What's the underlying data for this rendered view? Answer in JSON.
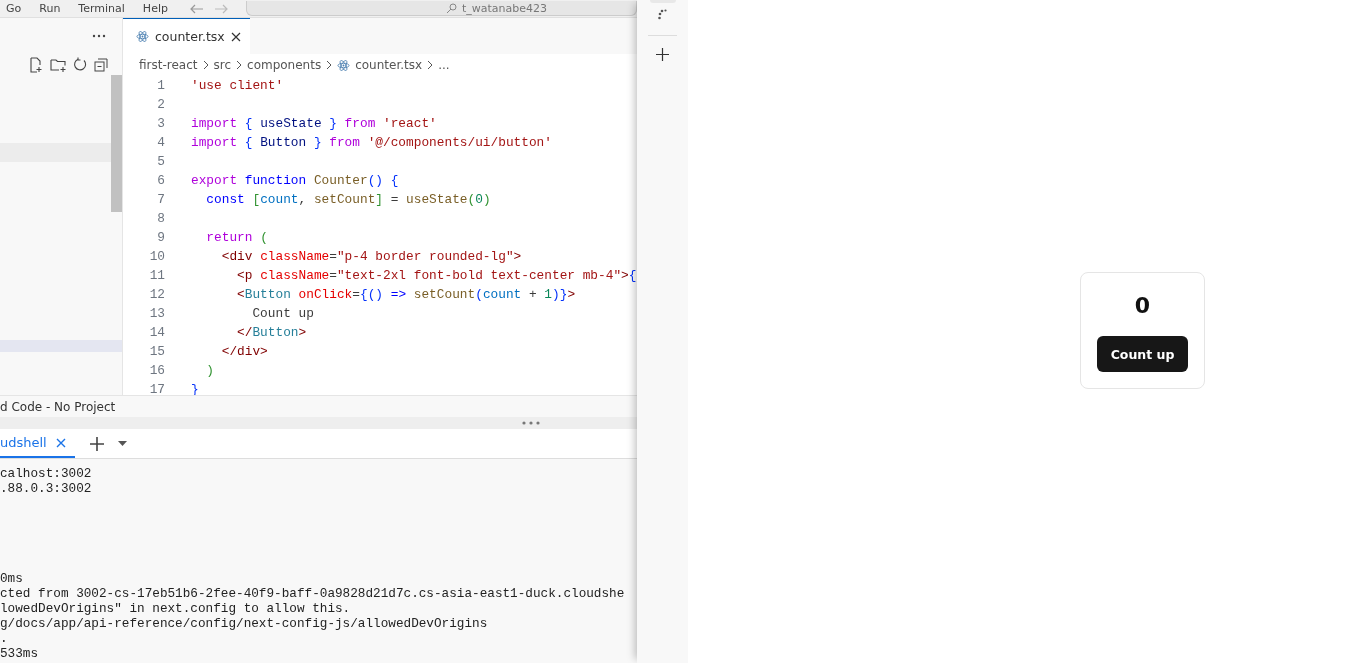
{
  "menu": [
    "Go",
    "Run",
    "Terminal",
    "Help"
  ],
  "command_center": {
    "text": "t_watanabe423"
  },
  "editor": {
    "tab": {
      "label": "counter.tsx",
      "selected": true
    },
    "breadcrumb": [
      "first-react",
      "src",
      "components",
      "counter.tsx",
      "..."
    ],
    "lines": [
      {
        "number": "1",
        "tokens": [
          {
            "text": "'use client'",
            "kind": "str"
          }
        ]
      },
      {
        "number": "2"
      },
      {
        "number": "3",
        "tokens": [
          {
            "text": "import ",
            "kind": "kw"
          },
          {
            "text": "{ ",
            "kind": "br1"
          },
          {
            "text": "useState ",
            "kind": "var"
          },
          {
            "text": "} ",
            "kind": "br1"
          },
          {
            "text": "from ",
            "kind": "kw"
          },
          {
            "text": "'react'",
            "kind": "str"
          }
        ]
      },
      {
        "number": "4",
        "tokens": [
          {
            "text": "import ",
            "kind": "kw"
          },
          {
            "text": "{ ",
            "kind": "br1"
          },
          {
            "text": "Button ",
            "kind": "var"
          },
          {
            "text": "} ",
            "kind": "br1"
          },
          {
            "text": "from ",
            "kind": "kw"
          },
          {
            "text": "'@/components/ui/button'",
            "kind": "str"
          }
        ]
      },
      {
        "number": "5"
      },
      {
        "number": "6",
        "tokens": [
          {
            "text": "export ",
            "kind": "kw"
          },
          {
            "text": "function ",
            "kind": "storage"
          },
          {
            "text": "Counter",
            "kind": "fn"
          },
          {
            "text": "() {",
            "kind": "br1"
          }
        ]
      },
      {
        "number": "7",
        "tokens": [
          {
            "text": "  const ",
            "kind": "storage"
          },
          {
            "text": "[",
            "kind": "br2"
          },
          {
            "text": "count",
            "kind": "var2"
          },
          {
            "text": ", ",
            "kind": "plain"
          },
          {
            "text": "setCount",
            "kind": "fn"
          },
          {
            "text": "]",
            "kind": "br2"
          },
          {
            "text": " = ",
            "kind": "plain"
          },
          {
            "text": "useState",
            "kind": "fn"
          },
          {
            "text": "(",
            "kind": "br2"
          },
          {
            "text": "0",
            "kind": "num"
          },
          {
            "text": ")",
            "kind": "br2"
          }
        ]
      },
      {
        "number": "8"
      },
      {
        "number": "9",
        "tokens": [
          {
            "text": "  return ",
            "kind": "kw"
          },
          {
            "text": "(",
            "kind": "br2"
          }
        ]
      },
      {
        "number": "10",
        "tokens": [
          {
            "text": "    <div ",
            "kind": "tag"
          },
          {
            "text": "className",
            "kind": "attr"
          },
          {
            "text": "=",
            "kind": "plain"
          },
          {
            "text": "\"p-4 border rounded-lg\"",
            "kind": "str"
          },
          {
            "text": ">",
            "kind": "tag"
          }
        ]
      },
      {
        "number": "11",
        "tokens": [
          {
            "text": "      <p ",
            "kind": "tag"
          },
          {
            "text": "className",
            "kind": "attr"
          },
          {
            "text": "=",
            "kind": "plain"
          },
          {
            "text": "\"text-2xl font-bold text-center mb-4\"",
            "kind": "str"
          },
          {
            "text": ">",
            "kind": "tag"
          },
          {
            "text": "{",
            "kind": "br1"
          }
        ]
      },
      {
        "number": "12",
        "tokens": [
          {
            "text": "      <",
            "kind": "tag"
          },
          {
            "text": "Button ",
            "kind": "comp"
          },
          {
            "text": "onClick",
            "kind": "attr"
          },
          {
            "text": "=",
            "kind": "plain"
          },
          {
            "text": "{",
            "kind": "br1"
          },
          {
            "text": "()",
            "kind": "br3"
          },
          {
            "text": " => ",
            "kind": "storage"
          },
          {
            "text": "setCount",
            "kind": "fn"
          },
          {
            "text": "(",
            "kind": "br3"
          },
          {
            "text": "count",
            "kind": "var2"
          },
          {
            "text": " + ",
            "kind": "plain"
          },
          {
            "text": "1",
            "kind": "num"
          },
          {
            "text": ")",
            "kind": "br3"
          },
          {
            "text": "}",
            "kind": "br1"
          },
          {
            "text": ">",
            "kind": "tag"
          }
        ]
      },
      {
        "number": "13",
        "tokens": [
          {
            "text": "        Count up",
            "kind": "plain"
          }
        ]
      },
      {
        "number": "14",
        "tokens": [
          {
            "text": "      </",
            "kind": "tag"
          },
          {
            "text": "Button",
            "kind": "comp"
          },
          {
            "text": ">",
            "kind": "tag"
          }
        ]
      },
      {
        "number": "15",
        "tokens": [
          {
            "text": "    </div>",
            "kind": "tag"
          }
        ]
      },
      {
        "number": "16",
        "tokens": [
          {
            "text": "  )",
            "kind": "br2"
          }
        ]
      },
      {
        "number": "17",
        "tokens": [
          {
            "text": "}",
            "kind": "br1"
          }
        ]
      }
    ]
  },
  "status_text": "d Code - No Project",
  "terminal": {
    "tab": {
      "label": "udshell",
      "selected": true
    },
    "output_blocks": [
      [
        "calhost:3002",
        ".88.0.3:3002"
      ],
      [
        "0ms",
        "cted from 3002-cs-17eb51b6-2fee-40f9-baff-0a9828d21d7c.cs-asia-east1-duck.cloudshe",
        "lowedDevOrigins\" in next.config to allow this.",
        "g/docs/app/api-reference/config/next-config-js/allowedDevOrigins",
        ".",
        "533ms"
      ]
    ]
  },
  "preview": {
    "count": "0",
    "button": "Count up"
  }
}
